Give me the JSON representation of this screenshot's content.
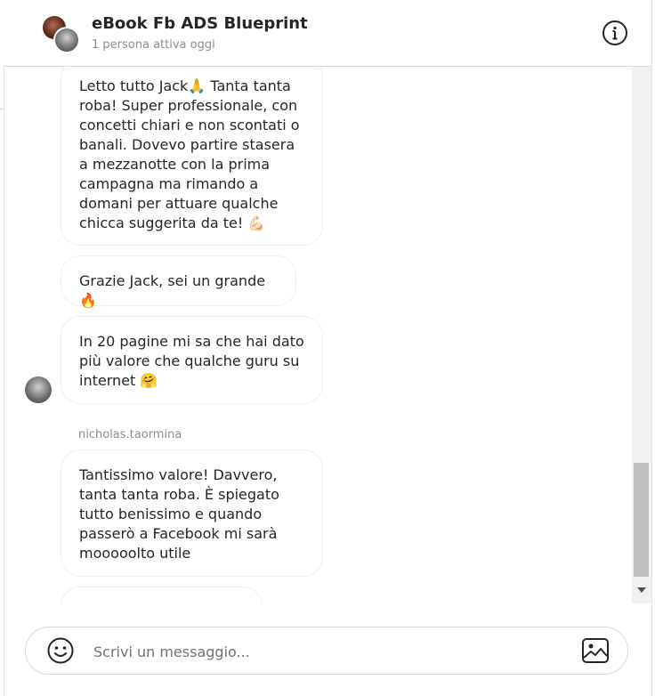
{
  "header": {
    "title": "eBook Fb ADS Blueprint",
    "subtitle": "1 persona attiva oggi",
    "info_icon": "info-circle-icon"
  },
  "messages": [
    {
      "text": "Letto tutto Jack🙏 Tanta tanta roba! Super professionale, con concetti chiari e non scontati o banali. Dovevo partire stasera a mezzanotte con la prima campagna ma rimando a domani per attuare qualche chicca suggerita da te! 💪🏻"
    },
    {
      "text": "Grazie Jack, sei un grande 🔥"
    },
    {
      "text": "In 20 pagine mi sa che hai dato più valore che qualche guru su internet 🤗"
    },
    {
      "text": "Tantissimo valore! Davvero, tanta tanta roba. È spiegato tutto benissimo e quando passerò a Facebook mi sarà mooooolto utile"
    }
  ],
  "username_label": "nicholas.taormina",
  "composer": {
    "placeholder": "Scrivi un messaggio...",
    "emoji_icon": "smiley-icon",
    "image_icon": "image-icon"
  }
}
